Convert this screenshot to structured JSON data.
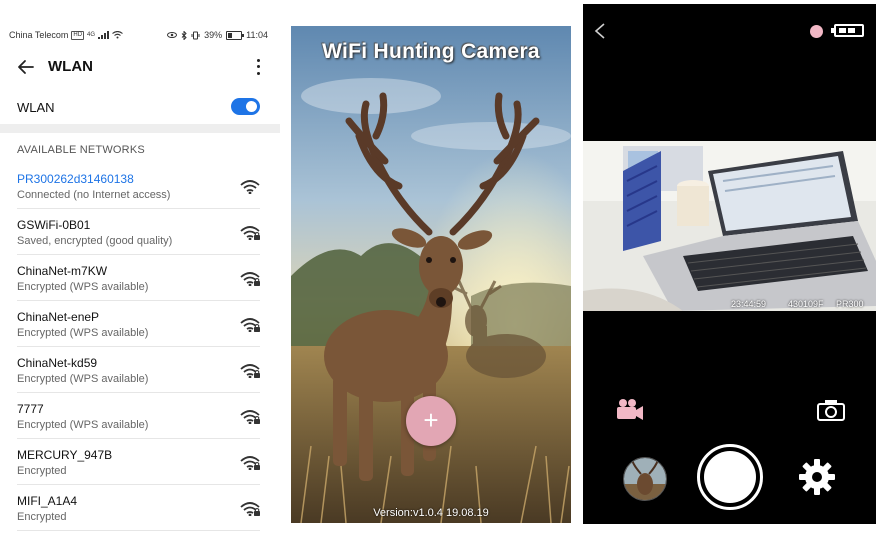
{
  "wlan_screen": {
    "status_bar": {
      "carrier": "China Telecom",
      "hd_badge": "HD",
      "network_type": "4G",
      "battery": "39%",
      "time": "11:04"
    },
    "title": "WLAN",
    "toggle_label": "WLAN",
    "toggle_on": true,
    "section_header": "AVAILABLE NETWORKS",
    "accent_color": "#1e74e6",
    "networks": [
      {
        "ssid": "PR300262d31460138",
        "status": "Connected (no Internet access)",
        "icon": "wifi-icon"
      },
      {
        "ssid": "GSWiFi-0B01",
        "status": "Saved, encrypted (good quality)",
        "icon": "wifi-lock-icon"
      },
      {
        "ssid": "ChinaNet-m7KW",
        "status": "Encrypted (WPS available)",
        "icon": "wifi-lock-icon"
      },
      {
        "ssid": "ChinaNet-eneP",
        "status": "Encrypted (WPS available)",
        "icon": "wifi-lock-icon"
      },
      {
        "ssid": "ChinaNet-kd59",
        "status": "Encrypted (WPS available)",
        "icon": "wifi-lock-icon"
      },
      {
        "ssid": "7777",
        "status": "Encrypted (WPS available)",
        "icon": "wifi-lock-icon"
      },
      {
        "ssid": "MERCURY_947B",
        "status": "Encrypted",
        "icon": "wifi-lock-icon"
      },
      {
        "ssid": "MIFI_A1A4",
        "status": "Encrypted",
        "icon": "wifi-lock-icon"
      }
    ]
  },
  "splash_screen": {
    "title": "WiFi Hunting Camera",
    "add_button": "+",
    "version": "Version:v1.0.4 19.08.19",
    "fab_color": "#e2a6b4"
  },
  "camera_screen": {
    "osd_time": "23:44:59",
    "osd_id": "430109F",
    "osd_model": "PR300",
    "record_indicator_color": "#f2b8c6",
    "icons": [
      "back-icon",
      "battery-icon",
      "video-camera-icon",
      "photo-camera-icon",
      "gallery-thumbnail",
      "shutter-button",
      "settings-gear-icon"
    ]
  }
}
